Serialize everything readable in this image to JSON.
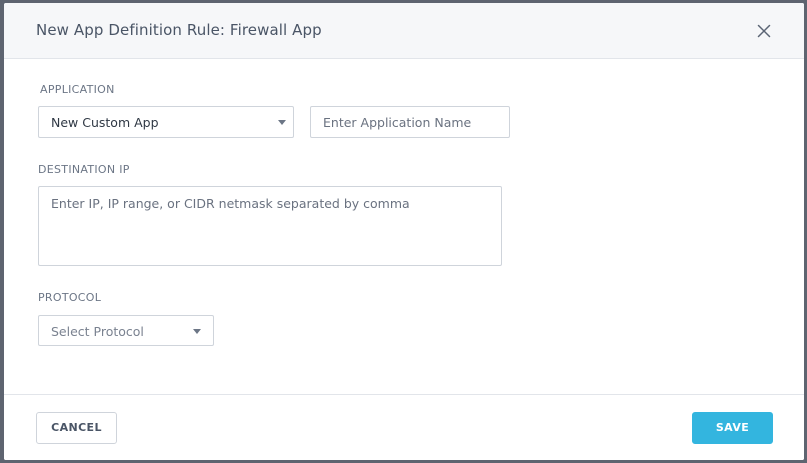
{
  "dialog": {
    "title": "New App Definition Rule: Firewall App",
    "close_icon": "close-icon"
  },
  "application": {
    "label": "APPLICATION",
    "select_value": "New Custom App",
    "name_placeholder": "Enter Application Name"
  },
  "destination_ip": {
    "label": "DESTINATION IP",
    "placeholder": "Enter IP, IP range, or CIDR netmask separated by comma"
  },
  "protocol": {
    "label": "PROTOCOL",
    "select_placeholder": "Select Protocol"
  },
  "footer": {
    "cancel_label": "CANCEL",
    "save_label": "SAVE"
  },
  "colors": {
    "accent": "#33b5df",
    "header_bg": "#f6f7f9",
    "text_primary": "#4a5566",
    "label": "#6c7686",
    "backdrop": "#5e6470"
  }
}
